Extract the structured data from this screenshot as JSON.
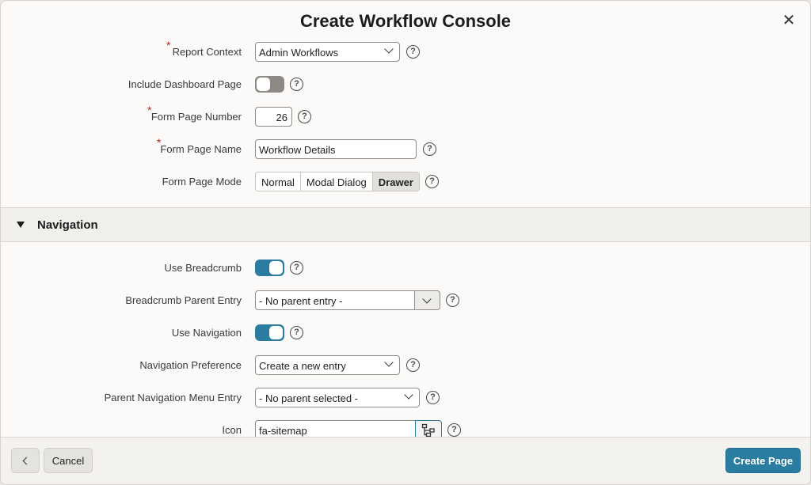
{
  "dialog": {
    "title": "Create Workflow Console",
    "close_icon": "close-icon"
  },
  "form": {
    "report_context": {
      "label": "Report Context",
      "value": "Admin Workflows",
      "required": true
    },
    "include_dashboard": {
      "label": "Include Dashboard Page",
      "state": "off"
    },
    "form_page_number": {
      "label": "Form Page Number",
      "value": "26",
      "required": true
    },
    "form_page_name": {
      "label": "Form Page Name",
      "value": "Workflow Details",
      "required": true
    },
    "form_page_mode": {
      "label": "Form Page Mode",
      "options": [
        "Normal",
        "Modal Dialog",
        "Drawer"
      ],
      "selected": "Drawer"
    }
  },
  "navigation": {
    "title": "Navigation",
    "use_breadcrumb": {
      "label": "Use Breadcrumb",
      "state": "on"
    },
    "breadcrumb_parent": {
      "label": "Breadcrumb Parent Entry",
      "value": "- No parent entry -"
    },
    "use_navigation": {
      "label": "Use Navigation",
      "state": "on"
    },
    "navigation_preference": {
      "label": "Navigation Preference",
      "value": "Create a new entry"
    },
    "parent_menu_entry": {
      "label": "Parent Navigation Menu Entry",
      "value": "- No parent selected -"
    },
    "icon": {
      "label": "Icon",
      "value": "fa-sitemap",
      "picker_icon": "sitemap-icon"
    }
  },
  "help_glyph": "?",
  "required_glyph": "*",
  "close_glyph": "✕",
  "footer": {
    "cancel_label": "Cancel",
    "create_label": "Create Page"
  },
  "colors": {
    "accent": "#2a7da0",
    "required": "#b3261e"
  }
}
